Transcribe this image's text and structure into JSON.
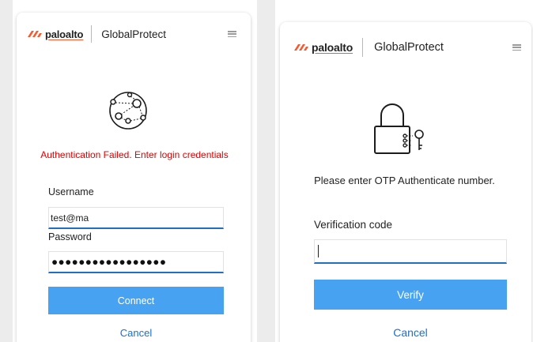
{
  "colors": {
    "accent_blue": "#47a3f2",
    "link_blue": "#1b70c8",
    "error_red": "#e00000",
    "brand_orange": "#fa582d",
    "field_underline": "#1f6fc5"
  },
  "left_panel": {
    "brand": {
      "logo_text": "paloalto",
      "product": "GlobalProtect"
    },
    "menu_icon": "hamburger-menu-icon",
    "hero_icon": "network-globe-icon",
    "error_message": "Authentication Failed. Enter login credentials",
    "username_label": "Username",
    "username_value": "test@ma",
    "password_label": "Password",
    "password_value": "●●●●●●●●●●●●●●●●●",
    "connect_label": "Connect",
    "cancel_label": "Cancel"
  },
  "right_panel": {
    "brand": {
      "logo_text": "paloalto",
      "product": "GlobalProtect"
    },
    "menu_icon": "hamburger-menu-icon",
    "hero_icon": "padlock-key-icon",
    "prompt": "Please enter OTP Authenticate number.",
    "verification_label": "Verification code",
    "verification_value": "",
    "verify_label": "Verify",
    "cancel_label": "Cancel"
  }
}
